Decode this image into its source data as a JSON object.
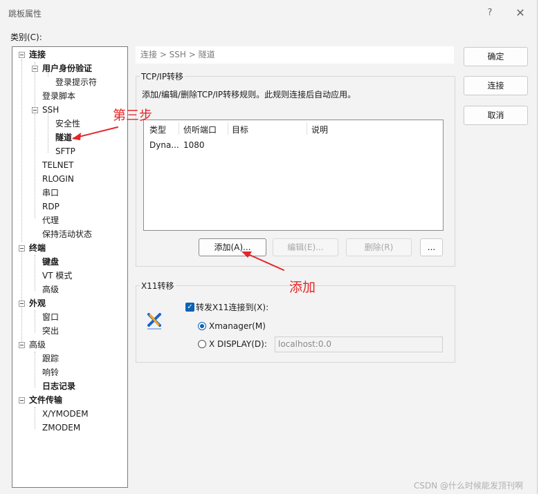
{
  "window": {
    "title": "跳板属性",
    "help_glyph": "?",
    "close_glyph": "✕"
  },
  "category_label": "类别(C):",
  "tree": {
    "lian_jie": "连接",
    "user_auth": "用户身份验证",
    "login_prompt": "登录提示符",
    "login_script": "登录脚本",
    "ssh": "SSH",
    "security": "安全性",
    "tunnel": "隧道",
    "sftp": "SFTP",
    "telnet": "TELNET",
    "rlogin": "RLOGIN",
    "serial": "串口",
    "rdp": "RDP",
    "proxy": "代理",
    "keepalive": "保持活动状态",
    "terminal": "终端",
    "keyboard": "键盘",
    "vt_mode": "VT 模式",
    "term_advanced": "高级",
    "appearance": "外观",
    "window": "窗口",
    "highlight": "突出",
    "advanced": "高级",
    "trace": "跟踪",
    "bell": "响铃",
    "logging": "日志记录",
    "file_transfer": "文件传输",
    "xymodem": "X/YMODEM",
    "zmodem": "ZMODEM"
  },
  "breadcrumb": "连接 > SSH > 隧道",
  "tcpip": {
    "group_title": "TCP/IP转移",
    "description": "添加/编辑/删除TCP/IP转移规则。此规则连接后自动应用。",
    "columns": [
      "类型",
      "侦听端口",
      "目标",
      "说明"
    ],
    "rows": [
      {
        "type": "Dyna...",
        "port": "1080",
        "target": "",
        "note": ""
      }
    ],
    "add_label": "添加(A)...",
    "edit_label": "编辑(E)...",
    "delete_label": "删除(R)",
    "more_label": "..."
  },
  "x11": {
    "group_title": "X11转移",
    "forward_label": "转发X11连接到(X):",
    "forward_checked": true,
    "xmanager_label": "Xmanager(M)",
    "display_label": "X DISPLAY(D):",
    "display_value": "localhost:0.0",
    "logo_letter": "X"
  },
  "buttons": {
    "ok": "确定",
    "connect": "连接",
    "cancel": "取消"
  },
  "annotations": {
    "step3": "第三步",
    "add": "添加"
  },
  "watermark": "CSDN @什么时候能发顶刊啊",
  "colors": {
    "accent": "#0b63b5",
    "annotation": "#e5262a"
  }
}
